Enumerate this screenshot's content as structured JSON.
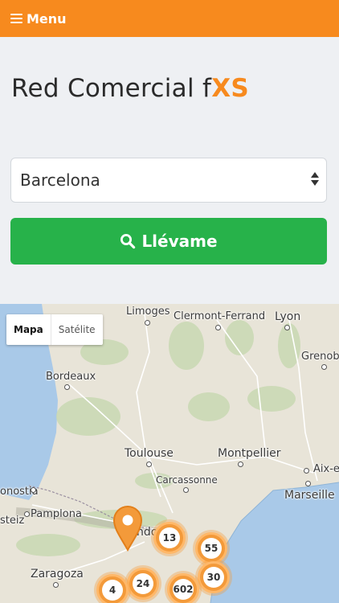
{
  "header": {
    "menu_label": "Menu",
    "menu_icon": "hamburger-icon",
    "background": "#f78a1e"
  },
  "title": {
    "text": "Red Comercial f",
    "brand": "XS"
  },
  "city_select": {
    "value": "Barcelona"
  },
  "go_button": {
    "label": "Llévame",
    "icon": "search-icon",
    "background": "#27b24a"
  },
  "map": {
    "type_control": {
      "map_label": "Mapa",
      "satellite_label": "Satélite",
      "selected": "Mapa"
    },
    "cities": {
      "limoges": "Limoges",
      "clermont": "Clermont-Ferrand",
      "lyon": "Lyon",
      "grenoble": "Grenobl",
      "bordeaux": "Bordeaux",
      "toulouse": "Toulouse",
      "montpellier": "Montpellier",
      "carcassonne": "Carcassonne",
      "aix": "Aix-e",
      "marseille": "Marseille",
      "donostia": "onostia",
      "pamplona": "Pamplona",
      "steiz": "steiz",
      "zaragoza": "Zaragoza",
      "andorra": "ndo"
    },
    "clusters": {
      "c13": "13",
      "c55": "55",
      "c30": "30",
      "c602": "602",
      "c24": "24",
      "c4": "4"
    },
    "cluster_color": "#f39a3a"
  }
}
